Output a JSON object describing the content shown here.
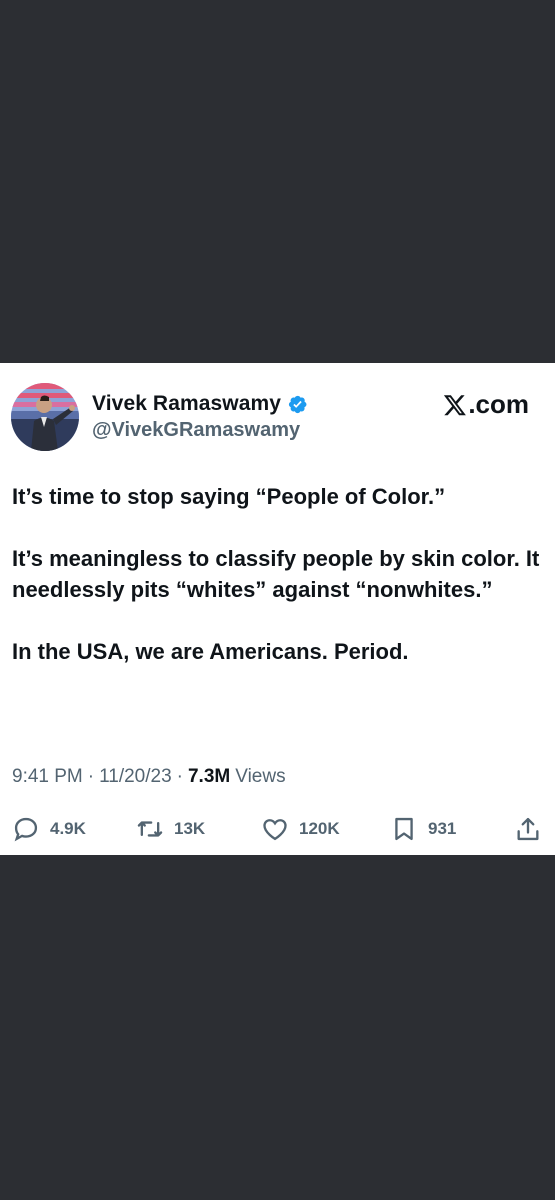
{
  "colors": {
    "background": "#2c2e33",
    "card": "#ffffff",
    "text": "#0f1419",
    "muted": "#536471",
    "verified": "#1d9bf0"
  },
  "author": {
    "display_name": "Vivek Ramaswamy",
    "handle": "@VivekGRamaswamy",
    "verified_icon": "verified-badge-icon"
  },
  "brand": {
    "logo_icon": "x-logo-icon",
    "label": ".com"
  },
  "tweet": {
    "paragraphs": [
      "It’s time to stop saying “People of Color.”",
      "It’s meaningless to classify people by skin color.  It needlessly pits “whites” against “nonwhites.”",
      "In the USA, we are Americans. Period."
    ]
  },
  "meta": {
    "time": "9:41 PM",
    "date": "11/20/23",
    "views_count": "7.3M",
    "views_label": "Views"
  },
  "actions": {
    "replies": "4.9K",
    "reposts": "13K",
    "likes": "120K",
    "bookmarks": "931"
  }
}
